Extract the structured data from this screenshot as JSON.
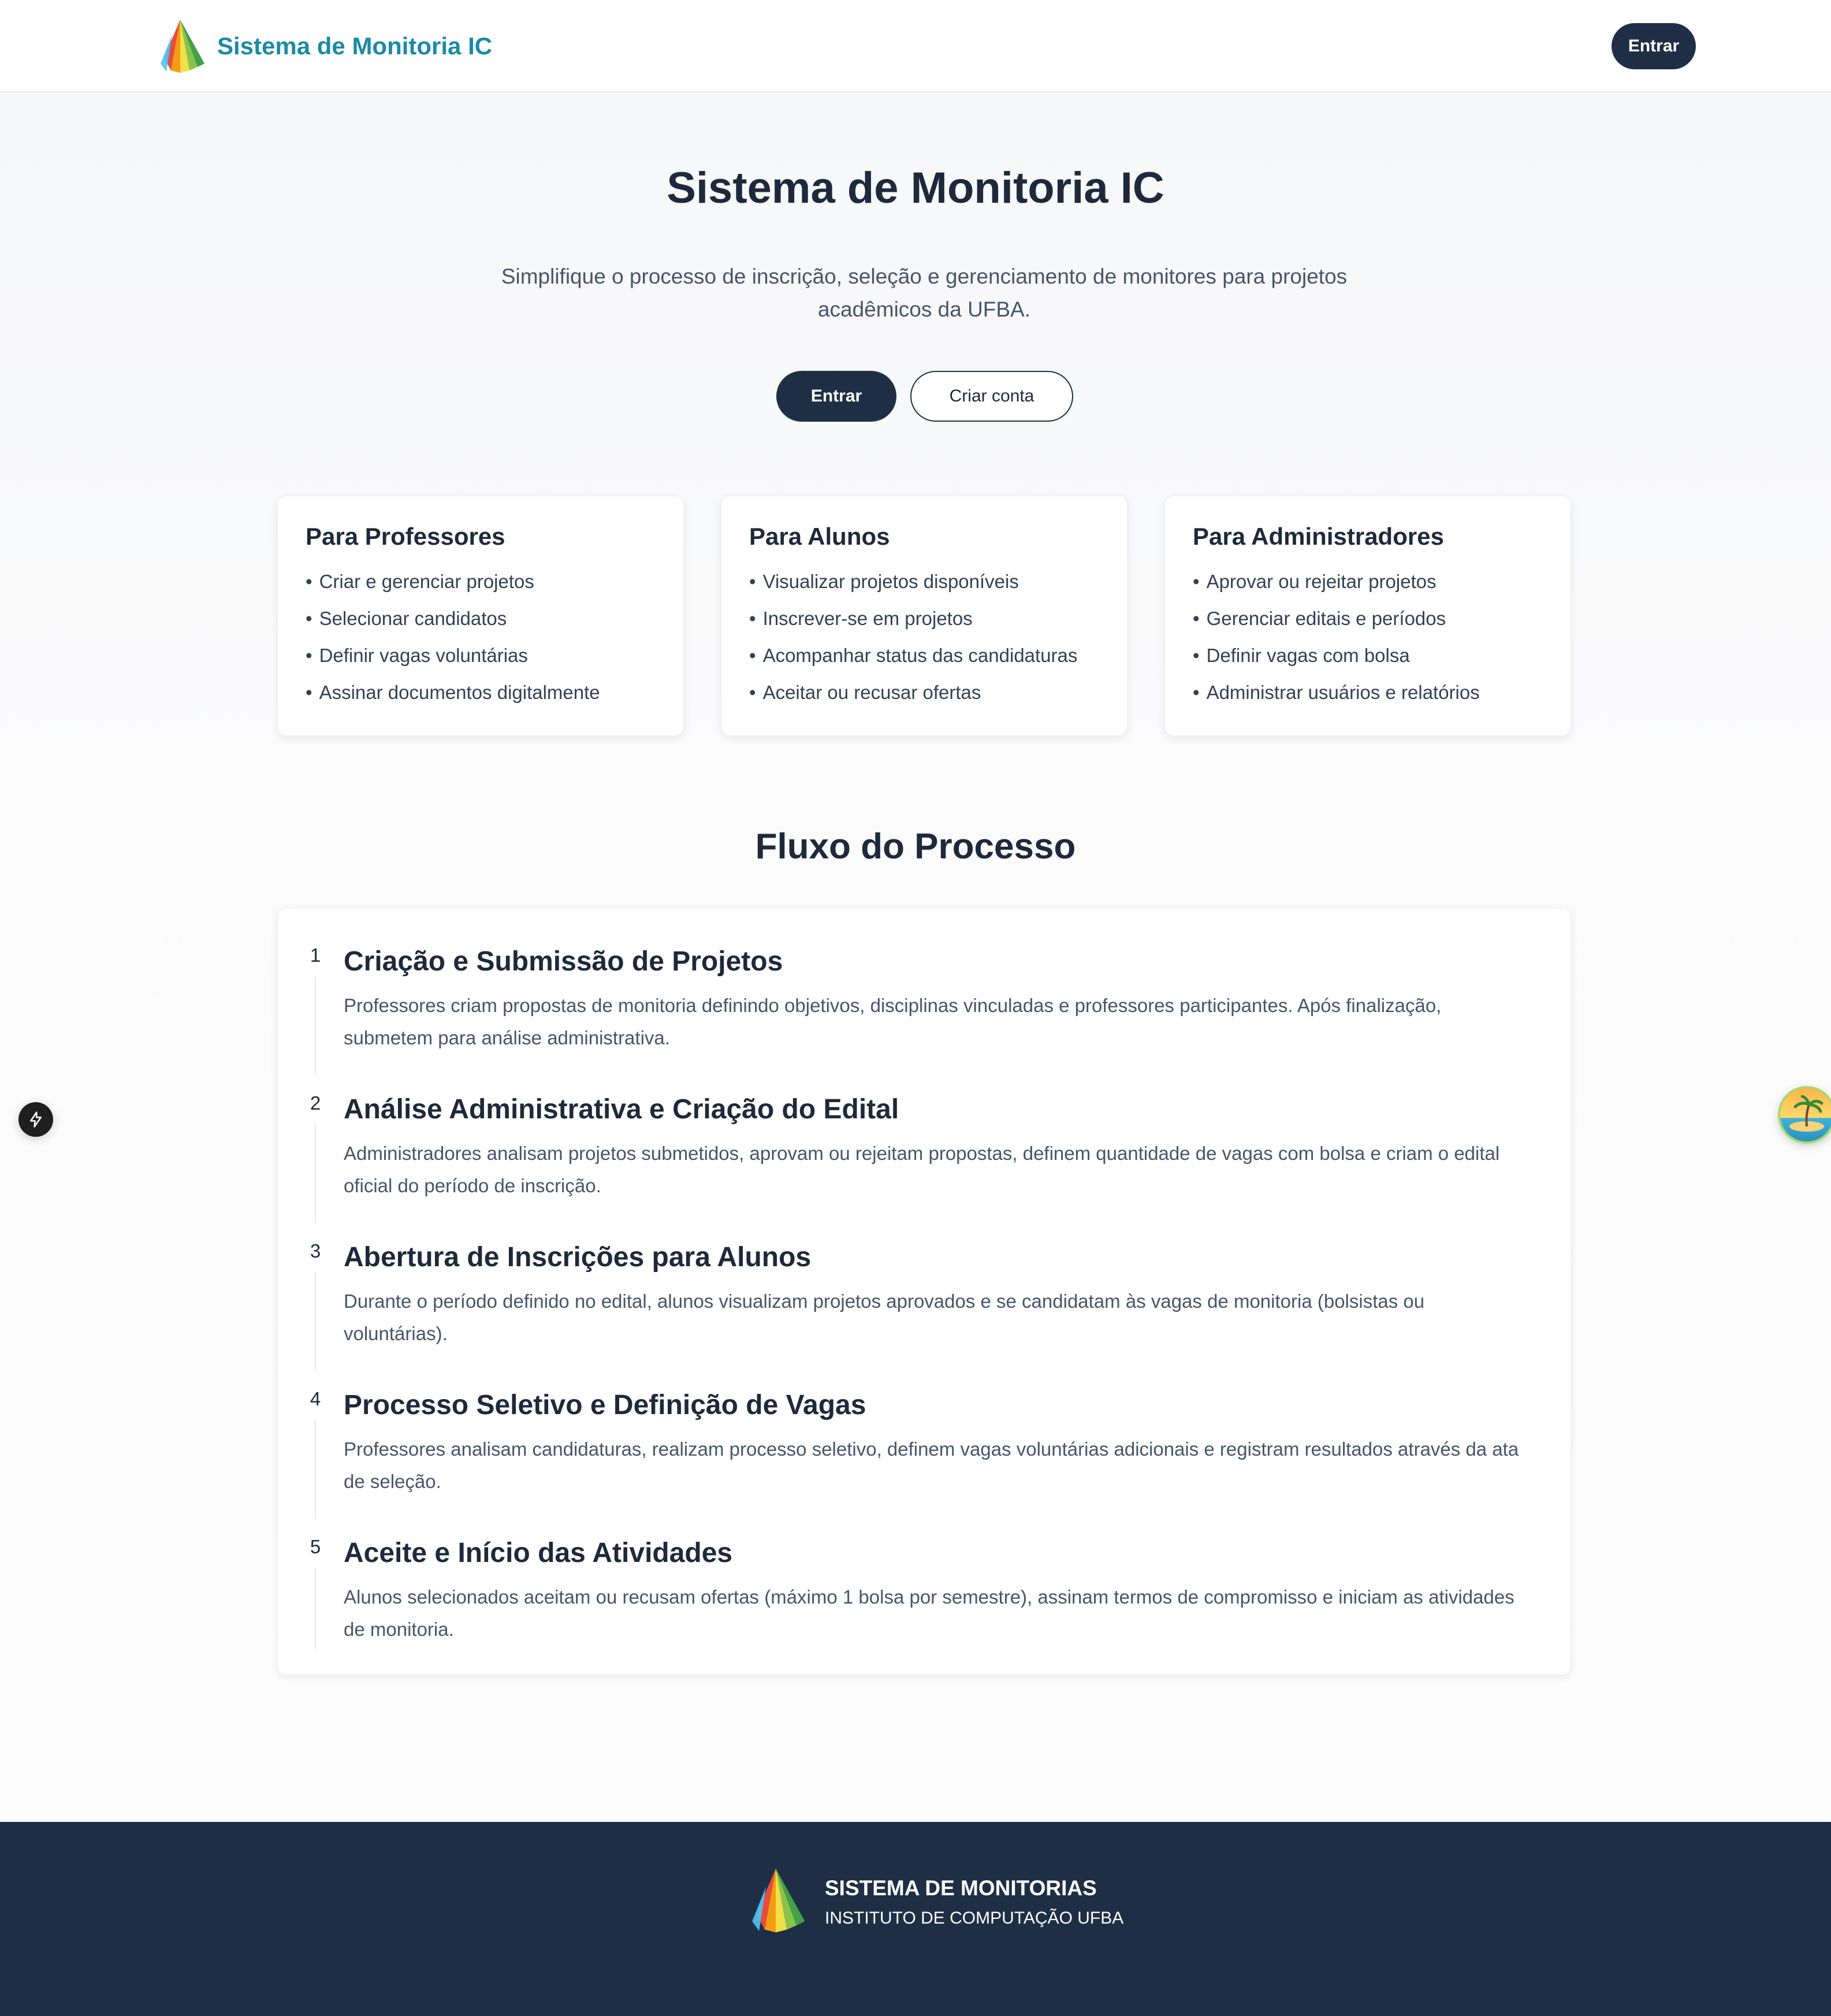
{
  "header": {
    "app_name": "Sistema de Monitoria IC",
    "login_label": "Entrar"
  },
  "hero": {
    "title": "Sistema de Monitoria IC",
    "subtitle": "Simplifique o processo de inscrição, seleção e gerenciamento de monitores para projetos acadêmicos da UFBA.",
    "login_label": "Entrar",
    "signup_label": "Criar conta"
  },
  "cards": [
    {
      "title": "Para Professores",
      "items": [
        "Criar e gerenciar projetos",
        "Selecionar candidatos",
        "Definir vagas voluntárias",
        "Assinar documentos digitalmente"
      ]
    },
    {
      "title": "Para Alunos",
      "items": [
        "Visualizar projetos disponíveis",
        "Inscrever-se em projetos",
        "Acompanhar status das candidaturas",
        "Aceitar ou recusar ofertas"
      ]
    },
    {
      "title": "Para Administradores",
      "items": [
        "Aprovar ou rejeitar projetos",
        "Gerenciar editais e períodos",
        "Definir vagas com bolsa",
        "Administrar usuários e relatórios"
      ]
    }
  ],
  "flow": {
    "title": "Fluxo do Processo",
    "steps": [
      {
        "number": "1",
        "title": "Criação e Submissão de Projetos",
        "description": "Professores criam propostas de monitoria definindo objetivos, disciplinas vinculadas e professores participantes. Após finalização, submetem para análise administrativa."
      },
      {
        "number": "2",
        "title": "Análise Administrativa e Criação do Edital",
        "description": "Administradores analisam projetos submetidos, aprovam ou rejeitam propostas, definem quantidade de vagas com bolsa e criam o edital oficial do período de inscrição."
      },
      {
        "number": "3",
        "title": "Abertura de Inscrições para Alunos",
        "description": "Durante o período definido no edital, alunos visualizam projetos aprovados e se candidatam às vagas de monitoria (bolsistas ou voluntárias)."
      },
      {
        "number": "4",
        "title": "Processo Seletivo e Definição de Vagas",
        "description": "Professores analisam candidaturas, realizam processo seletivo, definem vagas voluntárias adicionais e registram resultados através da ata de seleção."
      },
      {
        "number": "5",
        "title": "Aceite e Início das Atividades",
        "description": "Alunos selecionados aceitam ou recusam ofertas (máximo 1 bolsa por semestre), assinam termos de compromisso e iniciam as atividades de monitoria."
      }
    ]
  },
  "footer": {
    "title": "SISTEMA DE MONITORIAS",
    "subtitle": "INSTITUTO DE COMPUTAÇÃO UFBA"
  },
  "icons": {
    "brand_logo": "sail-logo-icon",
    "left_float": "lightning-icon",
    "right_float": "island-avatar-icon"
  },
  "colors": {
    "brand_text": "#1b8aa6",
    "primary_dark": "#1e2f45",
    "heading": "#1e293b",
    "body_text": "#475569"
  }
}
